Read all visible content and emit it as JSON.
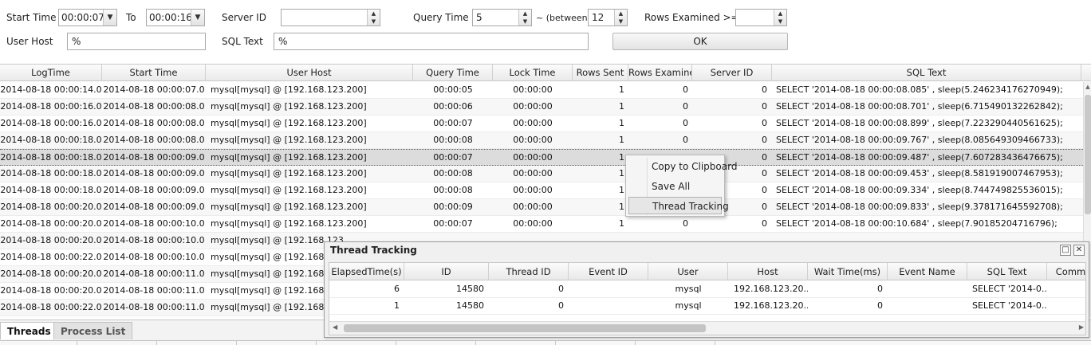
{
  "filters": {
    "start_time_label": "Start Time",
    "start_time_value": "00:00:07",
    "to_label": "To",
    "to_value": "00:00:16",
    "server_id_label": "Server ID",
    "server_id_value": "",
    "query_time_label": "Query Time",
    "query_time_min": "5",
    "between_label": "~ (between)",
    "query_time_max": "12",
    "rows_examined_label": "Rows Examined >=",
    "rows_examined_value": "",
    "user_host_label": "User Host",
    "user_host_value": "%",
    "sql_text_label": "SQL Text",
    "sql_text_value": "%",
    "ok_label": "OK"
  },
  "grid": {
    "columns": [
      "LogTime",
      "Start Time",
      "User Host",
      "Query Time",
      "Lock Time",
      "Rows Sent",
      "Rows Examined",
      "Server ID",
      "SQL Text"
    ],
    "rows": [
      [
        "2014-08-18 00:00:14.0",
        "2014-08-18 00:00:07.0",
        "mysql[mysql] @ [192.168.123.200]",
        "00:00:05",
        "00:00:00",
        "1",
        "0",
        "0",
        "SELECT '2014-08-18 00:00:08.085' , sleep(5.246234176270949);"
      ],
      [
        "2014-08-18 00:00:16.0",
        "2014-08-18 00:00:08.0",
        "mysql[mysql] @ [192.168.123.200]",
        "00:00:06",
        "00:00:00",
        "1",
        "0",
        "0",
        "SELECT '2014-08-18 00:00:08.701' , sleep(6.715490132262842);"
      ],
      [
        "2014-08-18 00:00:16.0",
        "2014-08-18 00:00:08.0",
        "mysql[mysql] @ [192.168.123.200]",
        "00:00:07",
        "00:00:00",
        "1",
        "0",
        "0",
        "SELECT '2014-08-18 00:00:08.899' , sleep(7.223290440561625);"
      ],
      [
        "2014-08-18 00:00:18.0",
        "2014-08-18 00:00:08.0",
        "mysql[mysql] @ [192.168.123.200]",
        "00:00:08",
        "00:00:00",
        "1",
        "0",
        "0",
        "SELECT '2014-08-18 00:00:09.767' , sleep(8.085649309466733);"
      ],
      [
        "2014-08-18 00:00:18.0",
        "2014-08-18 00:00:09.0",
        "mysql[mysql] @ [192.168.123.200]",
        "00:00:07",
        "00:00:00",
        "1",
        "",
        "0",
        "SELECT '2014-08-18 00:00:09.487' , sleep(7.607283436476675);"
      ],
      [
        "2014-08-18 00:00:18.0",
        "2014-08-18 00:00:09.0",
        "mysql[mysql] @ [192.168.123.200]",
        "00:00:08",
        "00:00:00",
        "1",
        "",
        "0",
        "SELECT '2014-08-18 00:00:09.453' , sleep(8.581919007467953);"
      ],
      [
        "2014-08-18 00:00:18.0",
        "2014-08-18 00:00:09.0",
        "mysql[mysql] @ [192.168.123.200]",
        "00:00:08",
        "00:00:00",
        "1",
        "",
        "0",
        "SELECT '2014-08-18 00:00:09.334' , sleep(8.744749825536015);"
      ],
      [
        "2014-08-18 00:00:20.0",
        "2014-08-18 00:00:09.0",
        "mysql[mysql] @ [192.168.123.200]",
        "00:00:09",
        "00:00:00",
        "1",
        "",
        "0",
        "SELECT '2014-08-18 00:00:09.833' , sleep(9.378171645592708);"
      ],
      [
        "2014-08-18 00:00:20.0",
        "2014-08-18 00:00:10.0",
        "mysql[mysql] @ [192.168.123.200]",
        "00:00:07",
        "00:00:00",
        "1",
        "0",
        "0",
        "SELECT '2014-08-18 00:00:10.684' , sleep(7.90185204716796);"
      ],
      [
        "2014-08-18 00:00:20.0",
        "2014-08-18 00:00:10.0",
        "mysql[mysql] @ [192.168.123.",
        "",
        "",
        "",
        "",
        "",
        ""
      ],
      [
        "2014-08-18 00:00:22.0",
        "2014-08-18 00:00:10.0",
        "mysql[mysql] @ [192.168.123",
        "",
        "",
        "",
        "",
        "",
        ""
      ],
      [
        "2014-08-18 00:00:20.0",
        "2014-08-18 00:00:11.0",
        "mysql[mysql] @ [192.168.123",
        "",
        "",
        "",
        "",
        "",
        ""
      ],
      [
        "2014-08-18 00:00:20.0",
        "2014-08-18 00:00:11.0",
        "mysql[mysql] @ [192.168.123",
        "",
        "",
        "",
        "",
        "",
        ""
      ],
      [
        "2014-08-18 00:00:22.0",
        "2014-08-18 00:00:11.0",
        "mysql[mysql] @ [192.168.123",
        "",
        "",
        "",
        "",
        "",
        ""
      ]
    ],
    "selected_row": 4
  },
  "context_menu": {
    "items": [
      "Copy to Clipboard",
      "Save All",
      "Thread Tracking"
    ]
  },
  "popup": {
    "title": "Thread Tracking",
    "columns": [
      "ElapsedTime(s)",
      "ID",
      "Thread ID",
      "Event ID",
      "User",
      "Host",
      "Wait Time(ms)",
      "Event Name",
      "SQL Text",
      "Comm"
    ],
    "rows": [
      [
        "6",
        "14580",
        "0",
        "",
        "mysql",
        "192.168.123.20...",
        "0",
        "",
        "SELECT '2014-0..."
      ],
      [
        "1",
        "14580",
        "0",
        "",
        "mysql",
        "192.168.123.20...",
        "0",
        "",
        "SELECT '2014-0..."
      ]
    ]
  },
  "tabs": [
    "Threads",
    "Process List"
  ]
}
